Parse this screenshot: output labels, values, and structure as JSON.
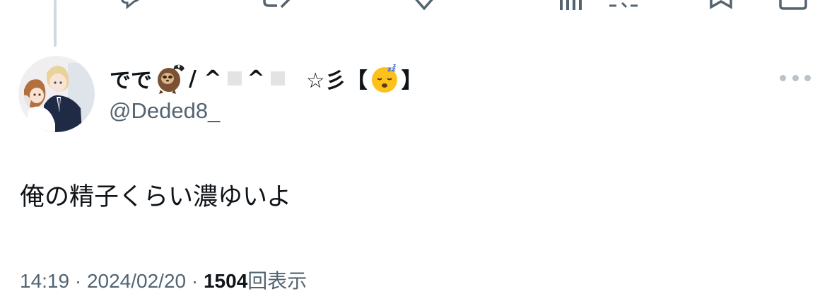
{
  "tweet": {
    "display_name_prefix": "でで",
    "display_name_mid1": "/ ^",
    "display_name_mid2": "^",
    "display_name_suffix_star": "☆彡【",
    "display_name_close": "】",
    "name_emojis": [
      "sloth-emoji",
      "sleeping-face-emoji"
    ],
    "handle": "@Deded8_",
    "text": "俺の精子くらい濃ゆいよ",
    "meta_time": "14:19 · 2024/02/20 · ",
    "meta_views_count": "1504",
    "meta_views_label": "回表示"
  },
  "icons": {
    "reply": "reply-icon",
    "retweet": "retweet-icon",
    "like": "like-icon",
    "views": "views-icon",
    "bookmark": "bookmark-icon",
    "share": "share-icon",
    "more": "more-icon"
  },
  "colors": {
    "text_primary": "#0f1419",
    "text_secondary": "#536471",
    "thread_line": "#cfd9de",
    "more_dots": "#b9c3ca"
  }
}
